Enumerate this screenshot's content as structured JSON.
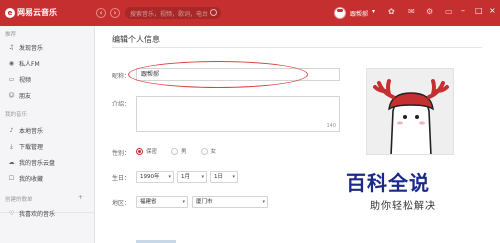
{
  "app": {
    "logo_text": "网易云音乐",
    "logo_mark": "e"
  },
  "topbar": {
    "back_icon": "‹",
    "forward_icon": "›",
    "search_placeholder": "搜索音乐，视频，歌词，电台",
    "username": "跟帮郝",
    "caret": "▾"
  },
  "sidebar": {
    "section_recommend": "推荐",
    "section_my_music": "我的音乐",
    "section_created": "创建的歌单",
    "items": [
      {
        "label": "发现音乐",
        "icon": "♫"
      },
      {
        "label": "私人FM",
        "icon": "◉"
      },
      {
        "label": "视频",
        "icon": "▭"
      },
      {
        "label": "朋友",
        "icon": "☺"
      },
      {
        "label": "本地音乐",
        "icon": "♪"
      },
      {
        "label": "下载管理",
        "icon": "⤓"
      },
      {
        "label": "我的音乐云盘",
        "icon": "☁"
      },
      {
        "label": "我的收藏",
        "icon": "☐"
      },
      {
        "label": "我喜欢的音乐",
        "icon": "♡"
      }
    ],
    "plus_icon": "+"
  },
  "main": {
    "title": "编辑个人信息",
    "nickname_label": "昵称：",
    "nickname_value": "跟帮郝",
    "intro_label": "介绍：",
    "intro_counter": "140",
    "gender_label": "性别：",
    "gender_options": [
      "保密",
      "男",
      "女"
    ],
    "birthday_label": "生日：",
    "birthday": {
      "year": "1990年",
      "month": "1月",
      "day": "1日"
    },
    "region_label": "地区：",
    "region": {
      "province": "福建省",
      "city": "厦门市"
    }
  },
  "watermark": {
    "line1": "百科全说",
    "line2": "助你轻松解决"
  },
  "colors": {
    "brand_red": "#c62f2f",
    "watermark_blue": "#1b2a8a"
  }
}
